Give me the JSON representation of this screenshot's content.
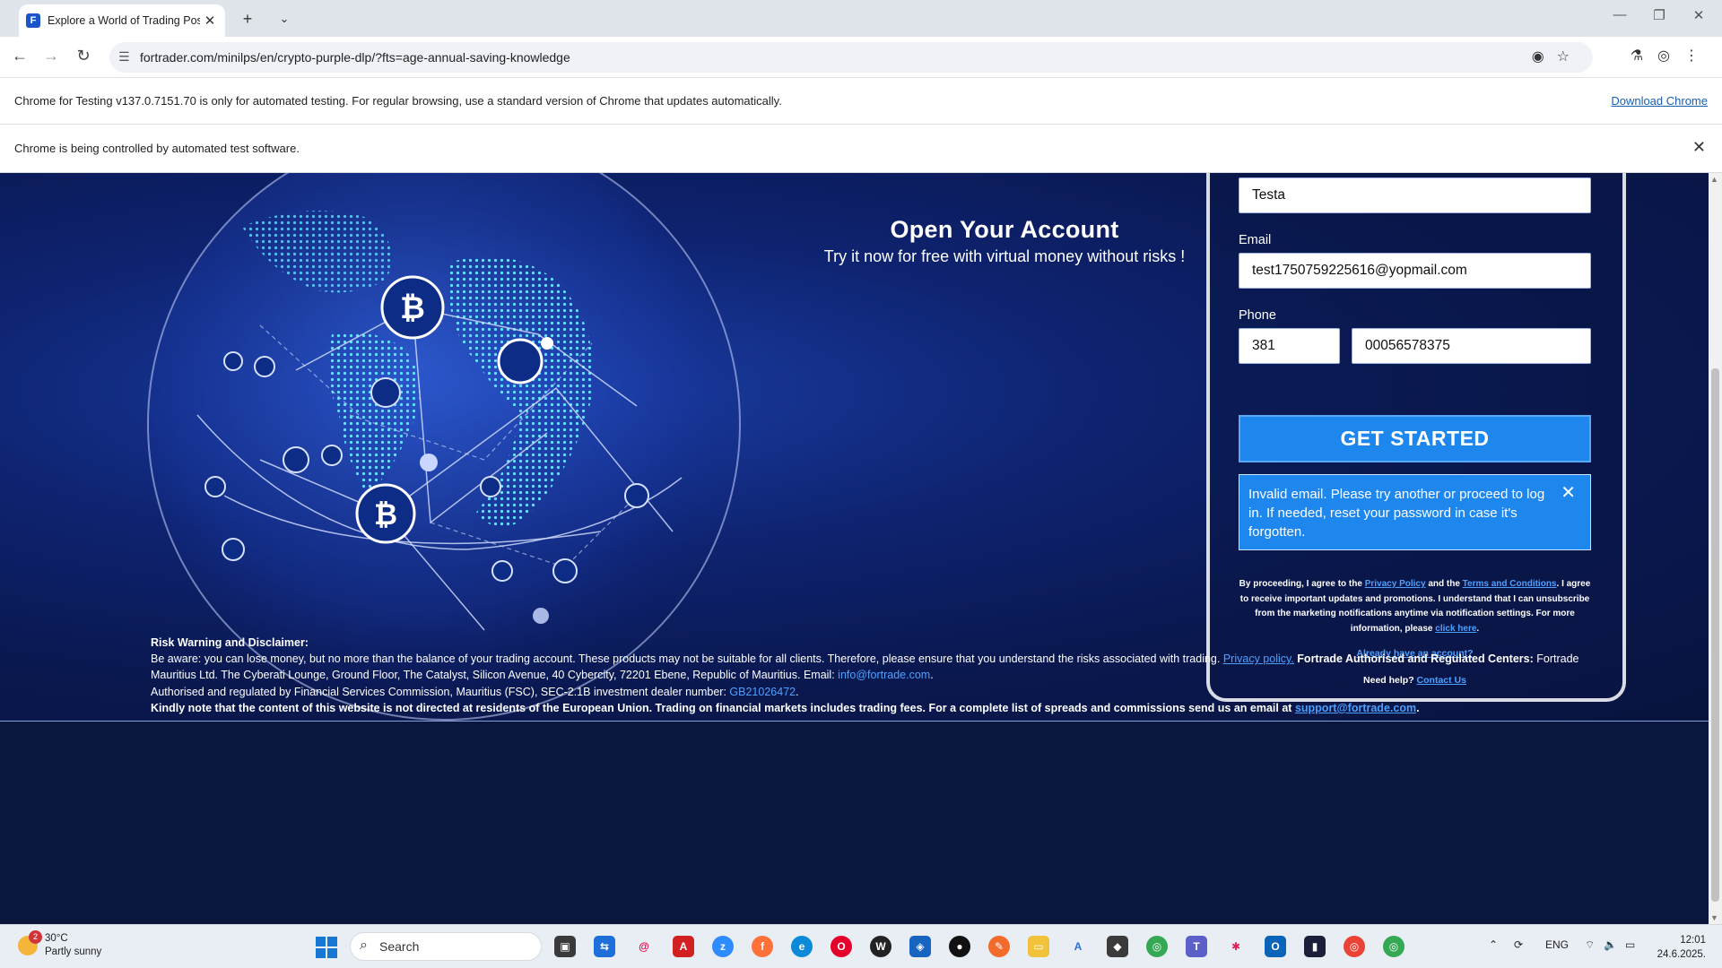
{
  "browser": {
    "tab_title": "Explore a World of Trading Poss",
    "url": "fortrader.com/minilps/en/crypto-purple-dlp/?fts=age-annual-saving-knowledge",
    "testing_notice": "Chrome for Testing v137.0.7151.70 is only for automated testing. For regular browsing, use a standard version of Chrome that updates automatically.",
    "download_link": "Download Chrome",
    "automation_notice": "Chrome is being controlled by automated test software."
  },
  "hero": {
    "title": "Open Your Account",
    "subtitle": "Try it now for free with virtual money without risks !"
  },
  "form": {
    "last_name_value": "Testa",
    "email_label": "Email",
    "email_value": "test1750759225616@yopmail.com",
    "phone_label": "Phone",
    "phone_code_value": "381",
    "phone_number_value": "00056578375",
    "submit_label": "GET STARTED",
    "error_message": "Invalid email. Please try another or proceed to log in. If needed, reset your password in case it's forgotten.",
    "legal_1": "By proceeding, I agree to the",
    "privacy_link": "Privacy Policy",
    "legal_and": "and the",
    "terms_link": "Terms and Conditions",
    "legal_2": "I agree to receive important updates and promotions. I understand that I can unsubscribe from the marketing notifications anytime via notification settings. For more information, please",
    "click_here": "click here",
    "already_account": "Already have an account?",
    "need_help": "Need help?",
    "contact_us": "Contact Us"
  },
  "footer": {
    "risk_title": "Risk Warning and Disclaimer:",
    "risk_text": "Be aware: you can lose money, but no more than the balance of your trading account. These products may not be suitable for all clients. Therefore, please ensure that you understand the risks associated with trading.",
    "privacy_link": "Privacy policy.",
    "centers_title": "Fortrade Authorised and Regulated Centers:",
    "address": "Fortrade Mauritius Ltd. The Cyberati Lounge, Ground Floor, The Catalyst, Silicon Avenue, 40 Cybercity, 72201 Ebene, Republic of Mauritius. Email:",
    "email_link": "info@fortrade.com",
    "regulation": "Authorised and regulated by Financial Services Commission, Mauritius (FSC), SEC-2.1B investment dealer number:",
    "dealer_link": "GB21026472",
    "eu_notice": "Kindly note that the content of this website is not directed at residents of the European Union. Trading on financial markets includes trading fees. For a complete list of spreads and commissions send us an email at",
    "support_link": "support@fortrade.com"
  },
  "taskbar": {
    "weather_temp": "30°C",
    "weather_desc": "Partly sunny",
    "weather_badge": "2",
    "search_placeholder": "Search",
    "language": "ENG",
    "time": "12:01",
    "date": "24.6.2025."
  }
}
